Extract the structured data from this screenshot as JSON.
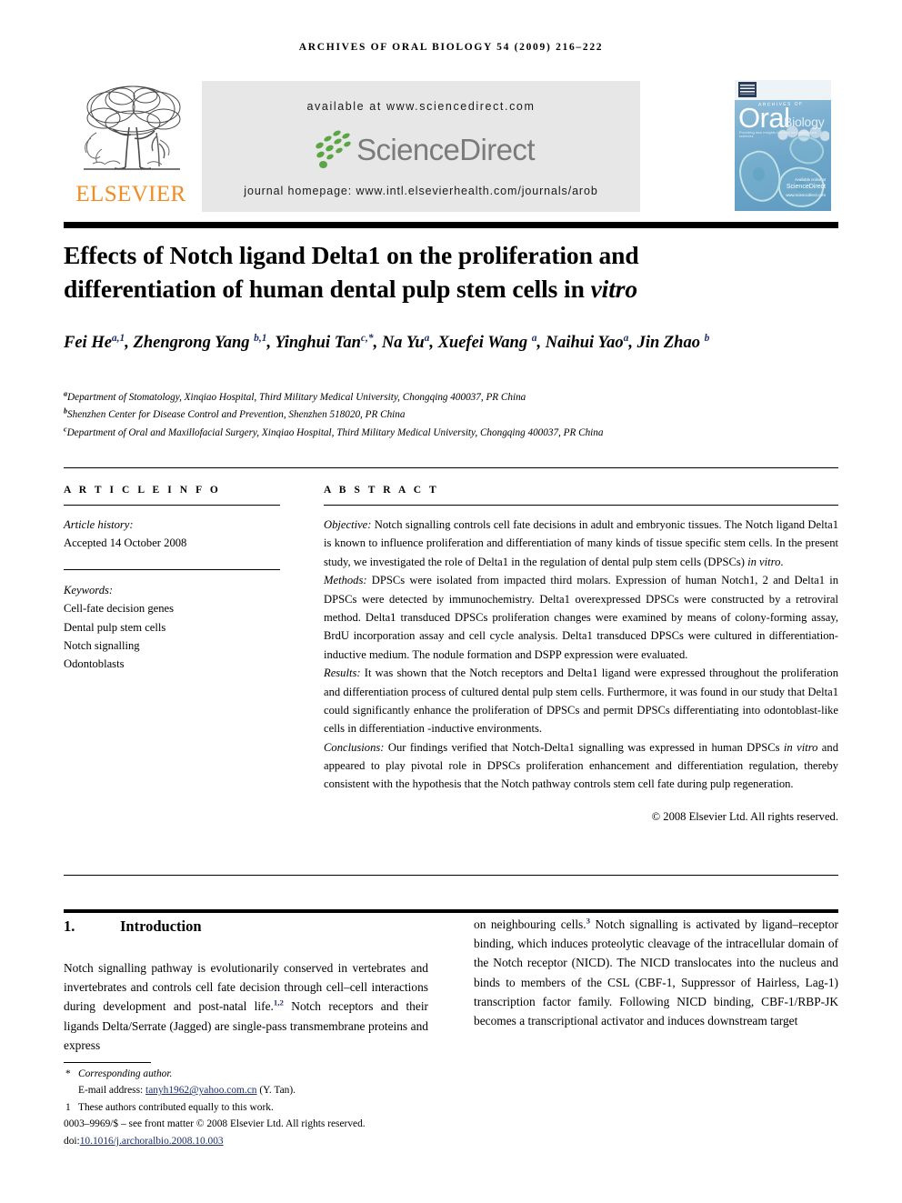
{
  "running_head": {
    "journal": "ARCHIVES OF ORAL BIOLOGY",
    "citation": "54 (2009) 216–222"
  },
  "masthead": {
    "publisher_logo_text": "ELSEVIER",
    "available_at": "available at www.sciencedirect.com",
    "sciencedirect_wordmark": "ScienceDirect",
    "journal_homepage": "journal homepage: www.intl.elsevierhealth.com/journals/arob",
    "cover": {
      "archives_of": "ARCHIVES OF",
      "oral": "Oral",
      "biology": "Biology",
      "subtitle": "Providing new insights into oral and craniofacial sciences",
      "sciencedirect_note_small": "Available online at",
      "sciencedirect_note": "ScienceDirect",
      "sciencedirect_url": "www.sciencedirect.com"
    }
  },
  "article": {
    "title_line1": "Effects of Notch ligand Delta1 on the proliferation and",
    "title_line2_pre": "differentiation of human dental pulp stem cells in ",
    "title_line2_italic": "vitro",
    "authors_html": "Fei He<sup>a,1</sup>, Zhengrong Yang <sup>b,1</sup>, Yinghui Tan<sup>c,*</sup>, Na Yu<sup>a</sup>, Xuefei Wang <sup>a</sup>, Naihui Yao<sup>a</sup>, Jin Zhao <sup>b</sup>",
    "affiliations": [
      {
        "mark": "a",
        "text": "Department of Stomatology, Xinqiao Hospital, Third Military Medical University, Chongqing 400037, PR China"
      },
      {
        "mark": "b",
        "text": "Shenzhen Center for Disease Control and Prevention, Shenzhen 518020, PR China"
      },
      {
        "mark": "c",
        "text": "Department of Oral and Maxillofacial Surgery, Xinqiao Hospital, Third Military Medical University, Chongqing 400037, PR China"
      }
    ]
  },
  "article_info": {
    "heading": "A R T I C L E   I N F O",
    "history_label": "Article history:",
    "history_value": "Accepted 14 October 2008",
    "keywords_label": "Keywords:",
    "keywords": [
      "Cell-fate decision genes",
      "Dental pulp stem cells",
      "Notch signalling",
      "Odontoblasts"
    ]
  },
  "abstract": {
    "heading": "A B S T R A C T",
    "sections": [
      {
        "label": "Objective:",
        "text": " Notch signalling controls cell fate decisions in adult and embryonic tissues. The Notch ligand Delta1 is known to influence proliferation and differentiation of many kinds of tissue specific stem cells. In the present study, we investigated the role of Delta1 in the regulation of dental pulp stem cells (DPSCs) ",
        "tail_italic": "in vitro",
        "tail": "."
      },
      {
        "label": "Methods:",
        "text": " DPSCs were isolated from impacted third molars. Expression of human Notch1, 2 and Delta1 in DPSCs were detected by immunochemistry. Delta1 overexpressed DPSCs were constructed by a retroviral method. Delta1 transduced DPSCs proliferation changes were examined by means of colony-forming assay, BrdU incorporation assay and cell cycle analysis. Delta1 transduced DPSCs were cultured in differentiation-inductive medium. The nodule formation and DSPP expression were evaluated.",
        "tail_italic": "",
        "tail": ""
      },
      {
        "label": "Results:",
        "text": " It was shown that the Notch receptors and Delta1 ligand were expressed throughout the proliferation and differentiation process of cultured dental pulp stem cells. Furthermore, it was found in our study that Delta1 could significantly enhance the proliferation of DPSCs and permit DPSCs differentiating into odontoblast-like cells in differentiation -inductive environments.",
        "tail_italic": "",
        "tail": ""
      },
      {
        "label": "Conclusions:",
        "text": " Our findings verified that Notch-Delta1 signalling was expressed in human DPSCs ",
        "tail_italic": "in vitro",
        "tail": " and appeared to play pivotal role in DPSCs proliferation enhancement and differentiation regulation, thereby consistent with the hypothesis that the Notch pathway controls stem cell fate during pulp regeneration."
      }
    ],
    "copyright": "© 2008 Elsevier Ltd. All rights reserved."
  },
  "introduction": {
    "number": "1.",
    "heading": "Introduction",
    "left_html": "Notch signalling pathway is evolutionarily conserved in vertebrates and invertebrates and controls cell fate decision through cell–cell interactions during development and post-natal life.<sup class=\"cite\">1,2</sup> Notch receptors and their ligands Delta/Serrate (Jagged) are single-pass transmembrane proteins and express",
    "right_html": "on neighbouring cells.<sup class=\"cite\">3</sup> Notch signalling is activated by ligand–receptor binding, which induces proteolytic cleavage of the intracellular domain of the Notch receptor (NICD). The NICD translocates into the nucleus and binds to members of the CSL (CBF-1, Suppressor of Hairless, Lag-1) transcription factor family. Following NICD binding, CBF-1/RBP-JK becomes a transcriptional activator and induces downstream target"
  },
  "footnotes": {
    "corresponding_mark": "*",
    "corresponding_text": "Corresponding author.",
    "email_label": "E-mail address:",
    "email": "tanyh1962@yahoo.com.cn",
    "email_attrib": "(Y. Tan).",
    "equal_mark": "1",
    "equal_text": "These authors contributed equally to this work.",
    "frontmatter": "0003–9969/$ – see front matter © 2008 Elsevier Ltd. All rights reserved.",
    "doi_label": "doi:",
    "doi": "10.1016/j.archoralbio.2008.10.003"
  },
  "colors": {
    "elsevier_orange": "#F08C22",
    "sciencedirect_green": "#5aa544",
    "sciencedirect_grey": "#7b7b7b",
    "link_blue": "#1c2f6b",
    "band_grey": "#e7e7e7"
  }
}
